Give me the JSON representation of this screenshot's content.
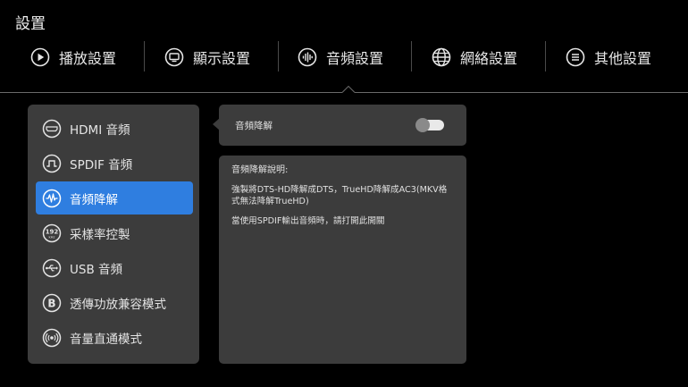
{
  "header": {
    "title": "設置"
  },
  "tabs": [
    {
      "label": "播放設置",
      "icon": "play-circle-icon"
    },
    {
      "label": "顯示設置",
      "icon": "display-icon"
    },
    {
      "label": "音頻設置",
      "icon": "audio-wave-icon",
      "selected": true
    },
    {
      "label": "網絡設置",
      "icon": "globe-icon"
    },
    {
      "label": "其他設置",
      "icon": "menu-circle-icon"
    }
  ],
  "menu": {
    "items": [
      {
        "label": "HDMI 音頻",
        "icon": "hdmi-icon"
      },
      {
        "label": "SPDIF 音頻",
        "icon": "spdif-icon"
      },
      {
        "label": "音頻降解",
        "icon": "waveform-icon",
        "active": true
      },
      {
        "label": "采樣率控製",
        "icon": "samplerate-192-icon",
        "icon_text": "192",
        "icon_subtext": "kHz"
      },
      {
        "label": "USB 音頻",
        "icon": "usb-icon"
      },
      {
        "label": "透傳功放兼容模式",
        "icon": "passthrough-b-icon",
        "icon_text": "B"
      },
      {
        "label": "音量直通模式",
        "icon": "volume-passthrough-icon"
      }
    ]
  },
  "setting": {
    "label": "音頻降解",
    "toggle_on": false
  },
  "description": {
    "title": "音頻降解說明:",
    "text": "強製將DTS-HD降解成DTS，TrueHD降解成AC3(MKV格式無法降解TrueHD)",
    "note": "當使用SPDIF輸出音頻時，請打開此開關"
  },
  "colors": {
    "background": "#000000",
    "panel": "#3c3c3c",
    "accent": "#2f7ee0",
    "separator": "#4a4a4a"
  }
}
